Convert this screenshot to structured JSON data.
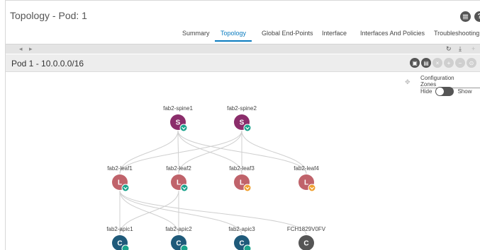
{
  "header": {
    "title": "Topology - Pod: 1",
    "icons": [
      "tools-icon",
      "help-icon"
    ],
    "help_glyph": "?"
  },
  "tabs": [
    {
      "label": "Summary",
      "active": false
    },
    {
      "label": "Topology",
      "active": true
    },
    {
      "label": "Global End-Points",
      "active": false
    },
    {
      "label": "Interface",
      "active": false
    },
    {
      "label": "Interfaces And Policies",
      "active": false
    },
    {
      "label": "Troubleshooting",
      "active": false
    }
  ],
  "pod_bar": {
    "title": "Pod 1 - 10.0.0.0/16"
  },
  "config_zones": {
    "label": "Configuration Zones",
    "hide_label": "Hide",
    "show_label": "Show",
    "state": "hide"
  },
  "colors": {
    "accent": "#0a7bbf",
    "spine": "#8b2d6b",
    "leaf": "#c0636b",
    "apic": "#1f5a7a",
    "unknown": "#555555",
    "badge_ok": "#1aa38c",
    "badge_warn": "#f0a030"
  },
  "nodes": {
    "spines": [
      {
        "name": "fab2-spine1",
        "letter": "S",
        "badge": "ok"
      },
      {
        "name": "fab2-spine2",
        "letter": "S",
        "badge": "ok"
      }
    ],
    "leaves": [
      {
        "name": "fab2-leaf1",
        "letter": "L",
        "badge": "ok"
      },
      {
        "name": "fab2-leaf2",
        "letter": "L",
        "badge": "ok"
      },
      {
        "name": "fab2-leaf3",
        "letter": "L",
        "badge": "warn"
      },
      {
        "name": "fab2-leaf4",
        "letter": "L",
        "badge": "warn"
      }
    ],
    "controllers": [
      {
        "name": "fab2-apic1",
        "letter": "C",
        "badge": "ok"
      },
      {
        "name": "fab2-apic2",
        "letter": "C",
        "badge": "ok"
      },
      {
        "name": "fab2-apic3",
        "letter": "C",
        "badge": "ok"
      },
      {
        "name": "FCH1829V0FV",
        "letter": "C",
        "badge": "none"
      }
    ]
  }
}
